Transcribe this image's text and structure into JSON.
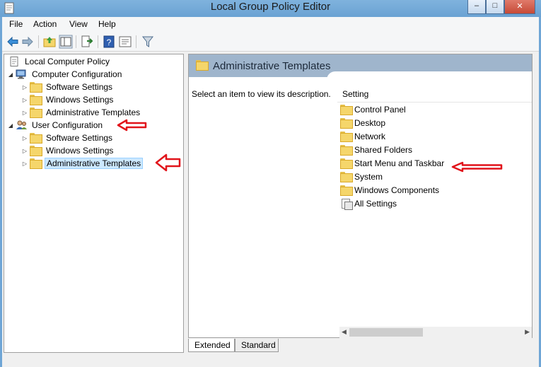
{
  "window": {
    "title": "Local Group Policy Editor",
    "controls": {
      "minimize": "–",
      "maximize": "□",
      "close": "✕"
    }
  },
  "menu": [
    {
      "label": "File"
    },
    {
      "label": "Action"
    },
    {
      "label": "View"
    },
    {
      "label": "Help"
    }
  ],
  "toolbar": {
    "buttons": [
      "back-icon",
      "forward-icon",
      "up-folder-icon",
      "show-hide-tree-icon",
      "export-list-icon",
      "help-icon",
      "properties-icon",
      "filter-icon"
    ]
  },
  "tree": {
    "root": "Local Computer Policy",
    "computer": {
      "label": "Computer Configuration",
      "children": [
        "Software Settings",
        "Windows Settings",
        "Administrative Templates"
      ]
    },
    "user": {
      "label": "User Configuration",
      "children": [
        "Software Settings",
        "Windows Settings",
        "Administrative Templates"
      ]
    }
  },
  "details": {
    "header_title": "Administrative Templates",
    "description": "Select an item to view its description.",
    "column_header": "Setting",
    "items": [
      "Control Panel",
      "Desktop",
      "Network",
      "Shared Folders",
      "Start Menu and Taskbar",
      "System",
      "Windows Components",
      "All Settings"
    ]
  },
  "tabs": [
    {
      "label": "Extended"
    },
    {
      "label": "Standard"
    }
  ],
  "colors": {
    "annotation_red": "#e1141b",
    "title_bar": "#6fa6d6",
    "selection": "#cce8ff"
  }
}
